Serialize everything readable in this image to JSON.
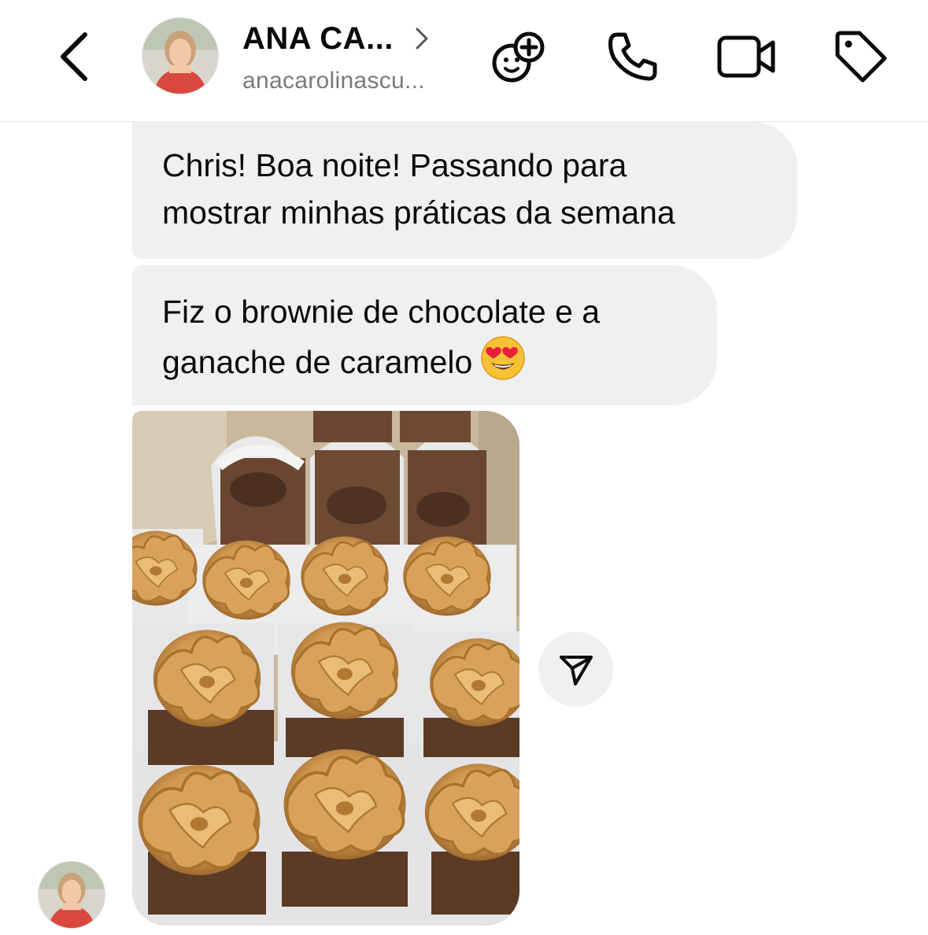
{
  "header": {
    "back_icon": "chevron-left-icon",
    "contact_name": "ANA CA...",
    "username": "anacarolinascu...",
    "actions": [
      {
        "icon": "add-friend-effects-icon"
      },
      {
        "icon": "phone-icon"
      },
      {
        "icon": "video-camera-icon"
      },
      {
        "icon": "tag-icon"
      }
    ]
  },
  "messages": [
    {
      "sender": "contact",
      "text_line1": "Chris! Boa noite! Passando para",
      "text_line2": "mostrar minhas práticas da semana"
    },
    {
      "sender": "contact",
      "text_line1": "Fiz o brownie de chocolate e a",
      "text_line2": "ganache de caramelo",
      "emoji": "heart-eyes-emoji"
    },
    {
      "sender": "contact",
      "type": "photo",
      "subject": "brownies with caramel ganache"
    }
  ],
  "share_icon": "send-icon",
  "colors": {
    "bubble": "#f0f0f2",
    "text": "#0a0a0a",
    "secondary_text": "#7a7a7a",
    "caramel": "#d9a25a",
    "brownie": "#5b3a26"
  }
}
